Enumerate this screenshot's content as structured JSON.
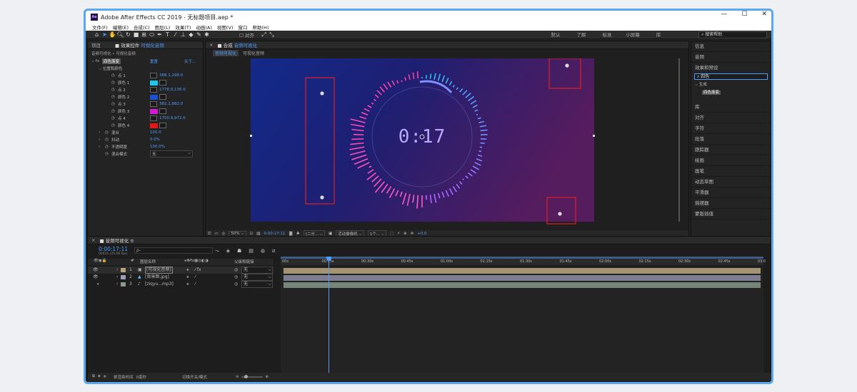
{
  "window": {
    "title": "Adobe After Effects CC 2019 - 无标题项目.aep *",
    "logo": "Ae"
  },
  "menu": [
    "文件(F)",
    "编辑(E)",
    "合成(C)",
    "图层(L)",
    "效果(T)",
    "动画(A)",
    "视图(V)",
    "窗口",
    "帮助(H)"
  ],
  "toolbar": {
    "snap_label": "对齐",
    "workspaces": [
      "默认",
      "了解",
      "标准",
      "小屏幕",
      "库"
    ],
    "search_placeholder": "搜索帮助"
  },
  "effects_panel": {
    "tab_project": "项目",
    "tab_effects": "效果控件",
    "tab_effects_target": "可视化音频",
    "breadcrumb": "音频可视化 • 可视化音频",
    "effect_name": "四色渐变",
    "reset_label": "重置",
    "about_label": "关于...",
    "group_label": "位置和颜色",
    "rows": [
      {
        "name": "点 1",
        "value": "388.1,298.0"
      },
      {
        "name": "颜色 1",
        "color": "#1ec8e8"
      },
      {
        "name": "点 2",
        "value": "1778.9,136.0"
      },
      {
        "name": "颜色 2",
        "color": "#1a4fd6"
      },
      {
        "name": "点 3",
        "value": "382.1,882.0"
      },
      {
        "name": "颜色 3",
        "color": "#d51bd4"
      },
      {
        "name": "点 4",
        "value": "1750.9,972.0"
      },
      {
        "name": "颜色 4",
        "color": "#e81515"
      }
    ],
    "feather": {
      "name": "混合",
      "value": "100.0"
    },
    "jitter": {
      "name": "抖动",
      "value": "0.0%"
    },
    "opacity": {
      "name": "不透明度",
      "value": "100.0%"
    },
    "blend": {
      "name": "混合模式",
      "value": "无"
    }
  },
  "composition": {
    "tab_label": "合成",
    "tab_name": "音频可视化",
    "inner_tab": "音频可视化",
    "inner_tab2": "可视化音频",
    "timecode_display": "0:17",
    "footer": {
      "zoom": "50%",
      "timecode": "0:00:17:11",
      "quality": "(二分...",
      "camera": "活动摄像机",
      "views": "1个...",
      "offset": "+0.0"
    }
  },
  "right_panel": {
    "items_top": [
      "信息",
      "音频",
      "效果和预设"
    ],
    "search_value": "四色",
    "tree_group": "生成",
    "tree_item": "四色渐变",
    "items_bottom": [
      "库",
      "对齐",
      "字符",
      "段落",
      "跟踪器",
      "绘画",
      "画笔",
      "动态草图",
      "平滑器",
      "摇摆器",
      "蒙版插值"
    ]
  },
  "timeline": {
    "tab_name": "音频可视化",
    "timecode": "0:00:17:11",
    "frames_info": "00431 (25.00 fps)",
    "search_placeholder": "ρ-",
    "col_layer": "图层名称",
    "col_parent": "父级和链接",
    "layers": [
      {
        "index": "1",
        "name": "[可视化音频]",
        "parent": "无",
        "color": "#b8a37f"
      },
      {
        "index": "2",
        "name": "[背景图.jpg]",
        "parent": "无",
        "color": "#9d9db8"
      },
      {
        "index": "3",
        "name": "[ziqyu...mp3]",
        "parent": "无",
        "color": "#8a9a8e"
      }
    ],
    "ruler": [
      "00s",
      "00:15s",
      "00:30s",
      "00:45s",
      "01:00s",
      "01:15s",
      "01:30s",
      "01:45s",
      "02:00s",
      "02:15s",
      "02:30s",
      "02:45s",
      "03:0"
    ],
    "footer_label": "切换开关/模式",
    "footer_frames": "帧渲染时间",
    "footer_frames2": "0毫秒"
  },
  "colors": {
    "accent": "#4d9cff",
    "highlight_box": "#e02020",
    "frame_border": "#5aa8ee"
  }
}
